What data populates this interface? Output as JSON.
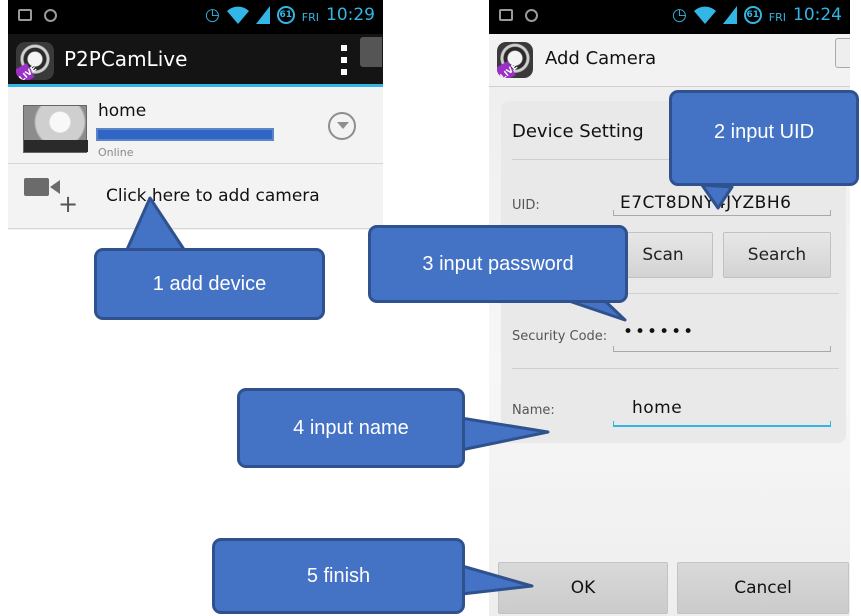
{
  "left_phone": {
    "status_bar": {
      "day": "FRI",
      "time": "10:29",
      "battery": "61"
    },
    "action_bar": {
      "title": "P2PCamLive"
    },
    "camera_list": [
      {
        "name": "home",
        "status": "Online"
      }
    ],
    "add_camera": {
      "label": "Click here to add camera"
    }
  },
  "right_phone": {
    "status_bar": {
      "day": "FRI",
      "time": "10:24",
      "battery": "61"
    },
    "action_bar": {
      "title": "Add Camera"
    },
    "device_setting": {
      "title": "Device Setting",
      "uid": {
        "label": "UID:",
        "value": "E7CT8DNY4JYZBH6"
      },
      "scan_button": "Scan",
      "search_button": "Search",
      "security_code": {
        "label": "Security Code:",
        "value": "••••••"
      },
      "name": {
        "label": "Name:",
        "value": "home"
      }
    },
    "ok_button": "OK",
    "cancel_button": "Cancel"
  },
  "callouts": {
    "step1": "1 add device",
    "step2": "2 input UID",
    "step3": "3 input password",
    "step4": "4 input name",
    "step5": "5 finish"
  },
  "colors": {
    "accent": "#33b5e5",
    "callout_fill": "#4472c4",
    "callout_border": "#2f528f",
    "redaction": "#2f66c6"
  }
}
